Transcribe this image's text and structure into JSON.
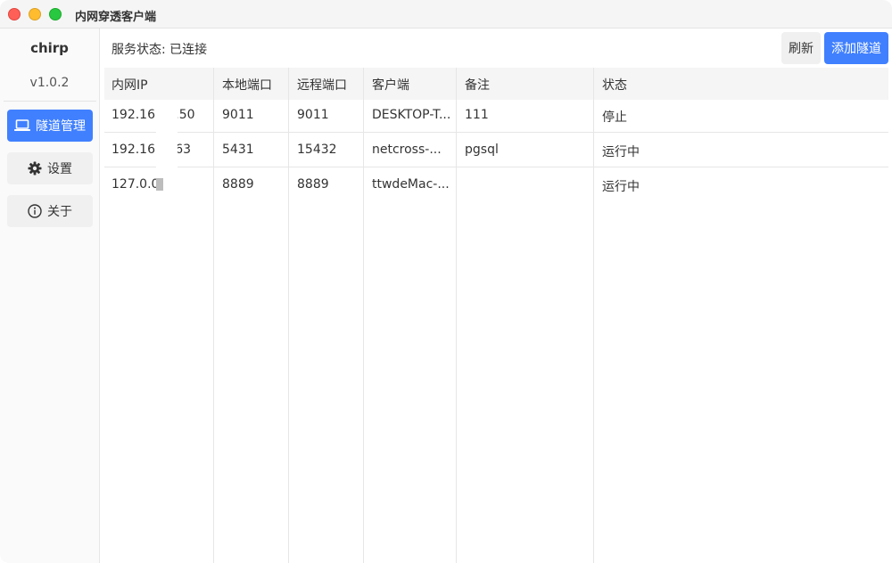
{
  "window": {
    "title": "内网穿透客户端"
  },
  "sidebar": {
    "app_name": "chirp",
    "version": "v1.0.2",
    "nav": [
      {
        "label": "隧道管理",
        "icon": "laptop-icon",
        "active": true
      },
      {
        "label": "设置",
        "icon": "gear-icon",
        "active": false
      },
      {
        "label": "关于",
        "icon": "info-icon",
        "active": false
      }
    ]
  },
  "header": {
    "status_text": "服务状态: 已连接",
    "refresh_label": "刷新",
    "add_label": "添加隧道"
  },
  "table": {
    "columns": [
      "内网IP",
      "本地端口",
      "远程端口",
      "客户端",
      "备注",
      "状态"
    ],
    "rows": [
      [
        "192.168.2.50",
        "9011",
        "9011",
        "DESKTOP-T...",
        "111",
        "停止"
      ],
      [
        "192.168.163",
        "5431",
        "15432",
        "netcross-...",
        "pgsql",
        "运行中"
      ],
      [
        "127.0.0.",
        "8889",
        "8889",
        "ttwdeMac-...",
        "",
        "运行中"
      ]
    ]
  },
  "colors": {
    "accent": "#4080ff",
    "header_bg": "#f5f5f5"
  }
}
